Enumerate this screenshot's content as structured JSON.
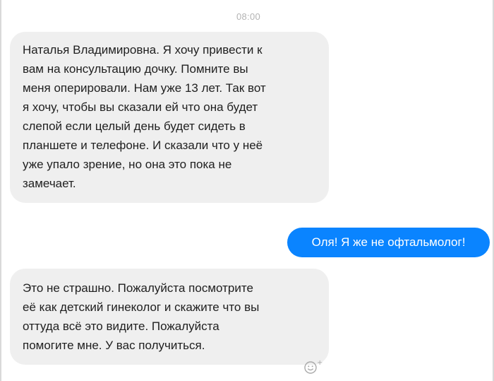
{
  "conversation": {
    "timestamp": "08:00",
    "messages": [
      {
        "direction": "incoming",
        "lines": [
          "Наталья Владимировна. Я хочу привести к",
          "вам на консультацию дочку. Помните вы",
          "меня оперировали. Нам уже 13 лет. Так вот",
          "я хочу, чтобы вы сказали ей что она будет",
          "слепой если целый день будет сидеть в",
          "планшете и телефоне. И сказали что у неё",
          "уже упало зрение, но она это пока не",
          "замечает."
        ]
      },
      {
        "direction": "outgoing",
        "lines": [
          "Оля! Я же не офтальмолог!"
        ]
      },
      {
        "direction": "incoming",
        "lines": [
          "Это не страшно. Пожалуйста посмотрите",
          "её как детский гинеколог и скажите что вы",
          "оттуда всё это видите. Пожалуйста",
          "помогите мне. У вас получиться."
        ]
      }
    ],
    "reaction_icon": "add-reaction-smiley-icon",
    "colors": {
      "incoming_bubble": "#efefef",
      "outgoing_bubble": "#0a84ff",
      "timestamp": "#b3b3b3"
    }
  }
}
